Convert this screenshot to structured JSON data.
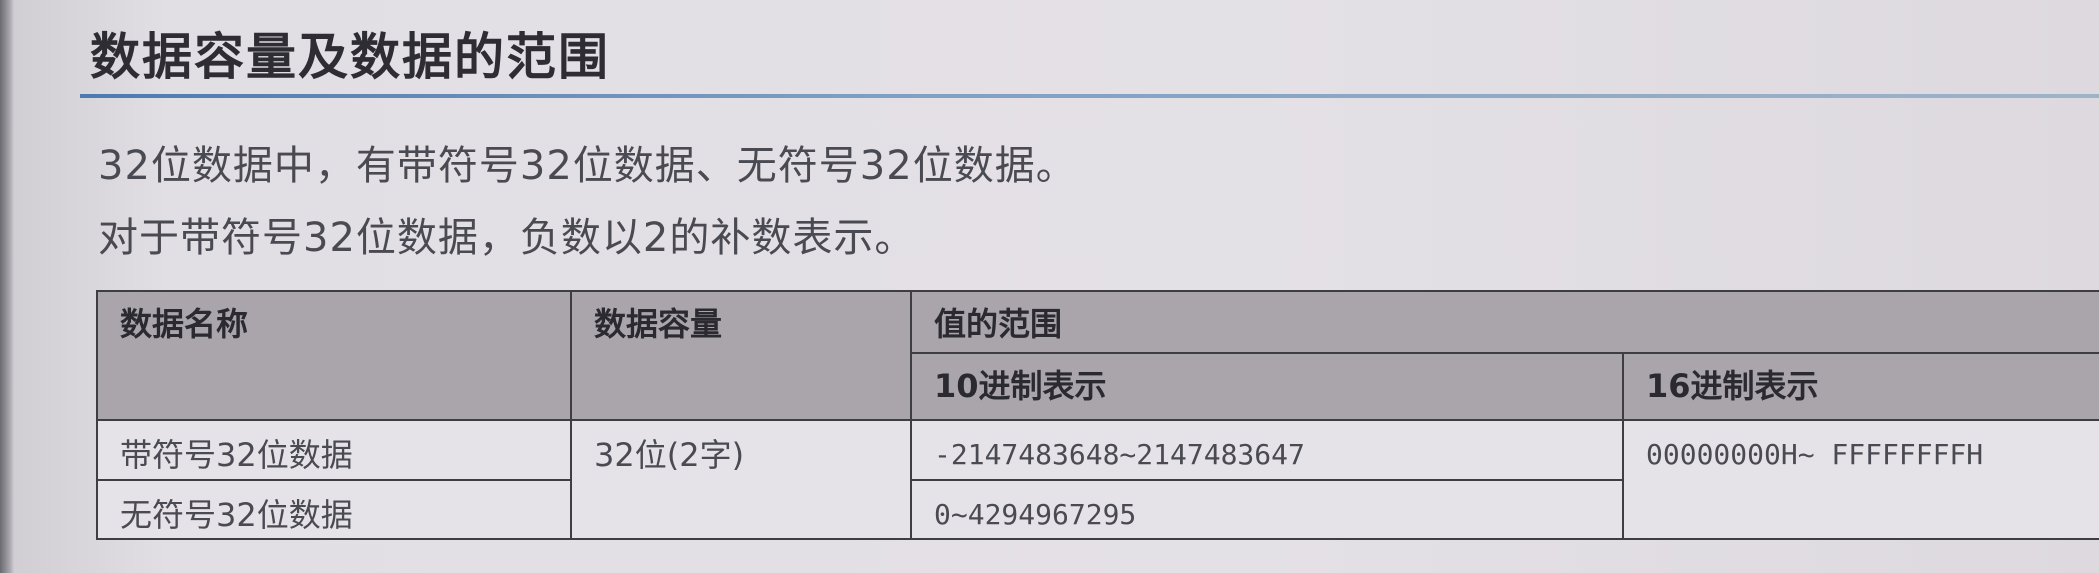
{
  "section": {
    "title": "数据容量及数据的范围",
    "lines": [
      "32位数据中，有带符号32位数据、无符号32位数据。",
      "对于带符号32位数据，负数以2的补数表示。"
    ]
  },
  "table": {
    "headers": {
      "name": "数据名称",
      "capacity": "数据容量",
      "range": "值的范围",
      "decimal": "10进制表示",
      "hex": "16进制表示"
    },
    "rows": [
      {
        "name": "带符号32位数据",
        "capacity": "32位(2字)",
        "decimal": "-2147483648~2147483647",
        "hex": "00000000H~ FFFFFFFFH"
      },
      {
        "name": "无符号32位数据",
        "decimal": "0~4294967295"
      }
    ]
  }
}
